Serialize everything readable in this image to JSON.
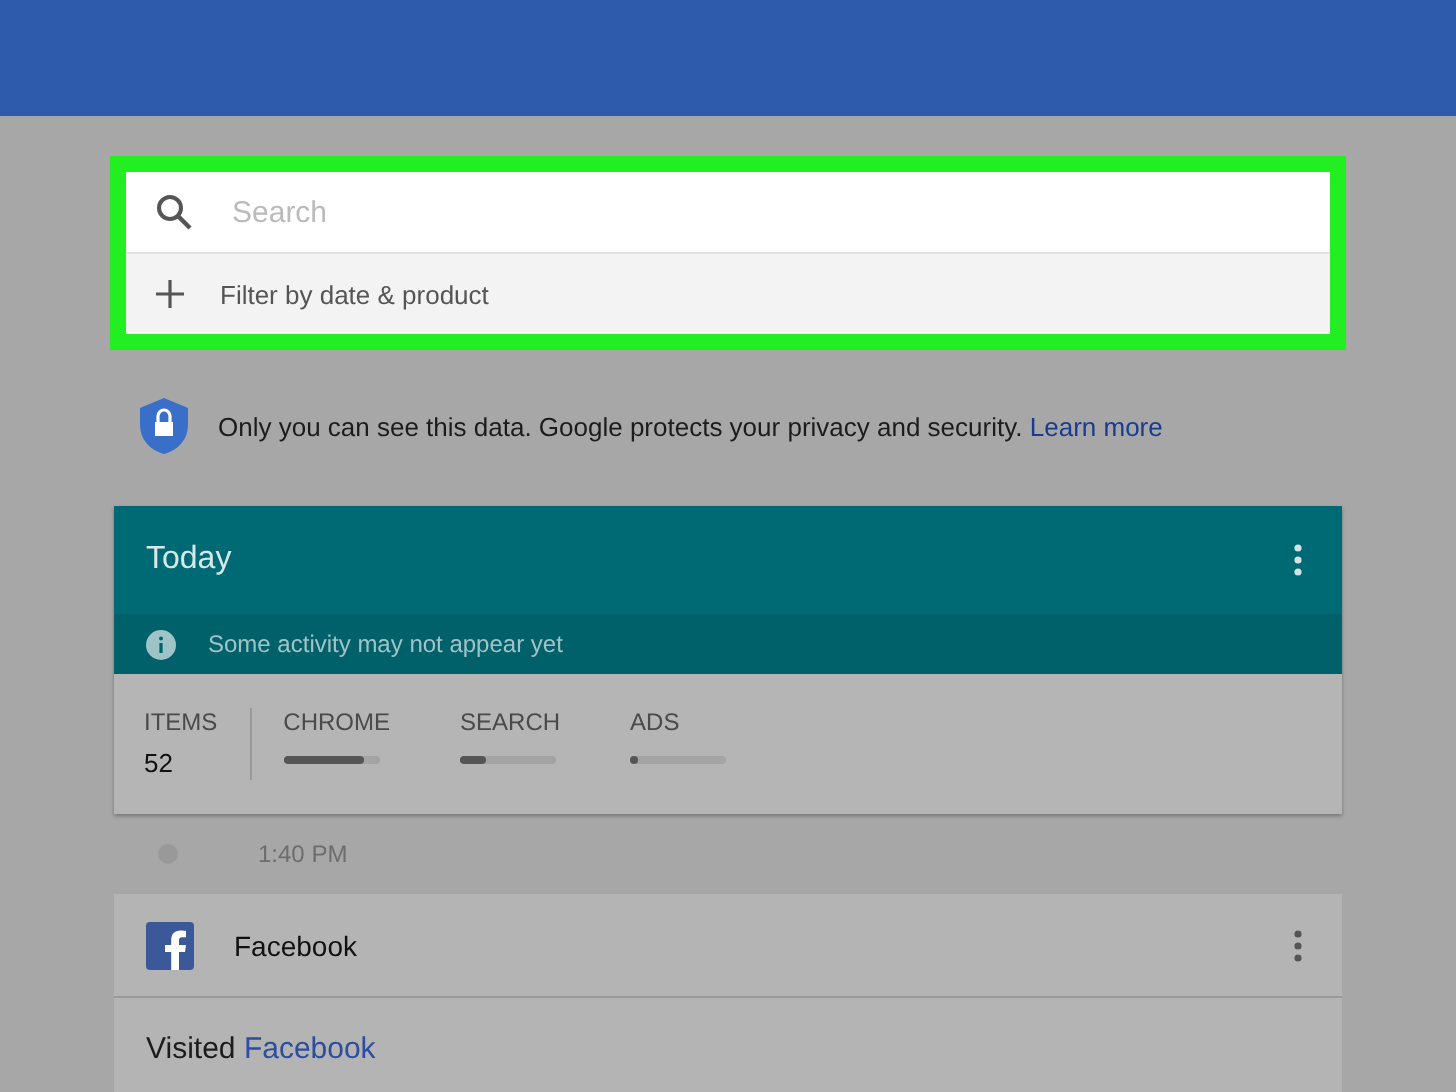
{
  "search": {
    "placeholder": "Search",
    "highlighted": true,
    "filter_label": "Filter by date & product"
  },
  "privacy": {
    "text": "Only you can see this data. Google protects your privacy and security.",
    "link": "Learn more"
  },
  "today_card": {
    "title": "Today",
    "notice": "Some activity may not appear yet",
    "stats": [
      {
        "kind": "count",
        "label": "ITEMS",
        "value": "52"
      },
      {
        "kind": "bar",
        "label": "CHROME",
        "level": 0.85
      },
      {
        "kind": "bar",
        "label": "SEARCH",
        "level": 0.28
      },
      {
        "kind": "bar",
        "label": "ADS",
        "level": 0.08
      }
    ]
  },
  "timeline": [
    {
      "time": "1:40 PM",
      "title": "Facebook",
      "visited_label": "Visited",
      "visited_link": "Facebook"
    }
  ]
}
